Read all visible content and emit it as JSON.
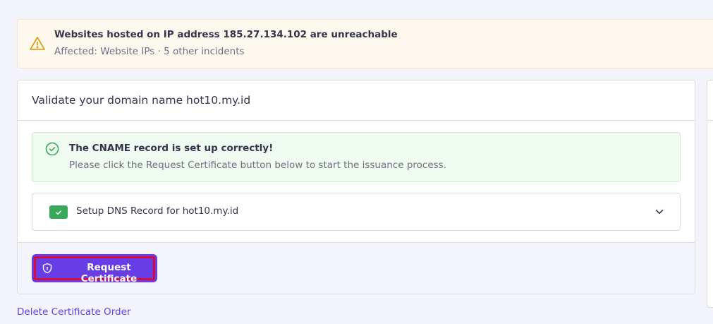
{
  "alert": {
    "icon": "warning-triangle-icon",
    "title": "Websites hosted on IP address 185.27.134.102 are unreachable",
    "subtitle": "Affected: Website IPs · 5 other incidents",
    "color": "#e0a21b"
  },
  "card": {
    "title": "Validate your domain name hot10.my.id",
    "success": {
      "icon": "check-circle-icon",
      "title": "The CNAME record is set up correctly!",
      "message": "Please click the Request Certificate button below to start the issuance process.",
      "color": "#3aa85a"
    },
    "accordion": {
      "icon": "checkmark-icon",
      "label": "Setup DNS Record for hot10.my.id",
      "expanded": false
    },
    "footer": {
      "button_label": "Request Certificate",
      "button_icon": "shield-icon",
      "accent": "#673de6",
      "highlight": "#d70a3a"
    }
  },
  "links": {
    "delete_order": "Delete Certificate Order"
  }
}
